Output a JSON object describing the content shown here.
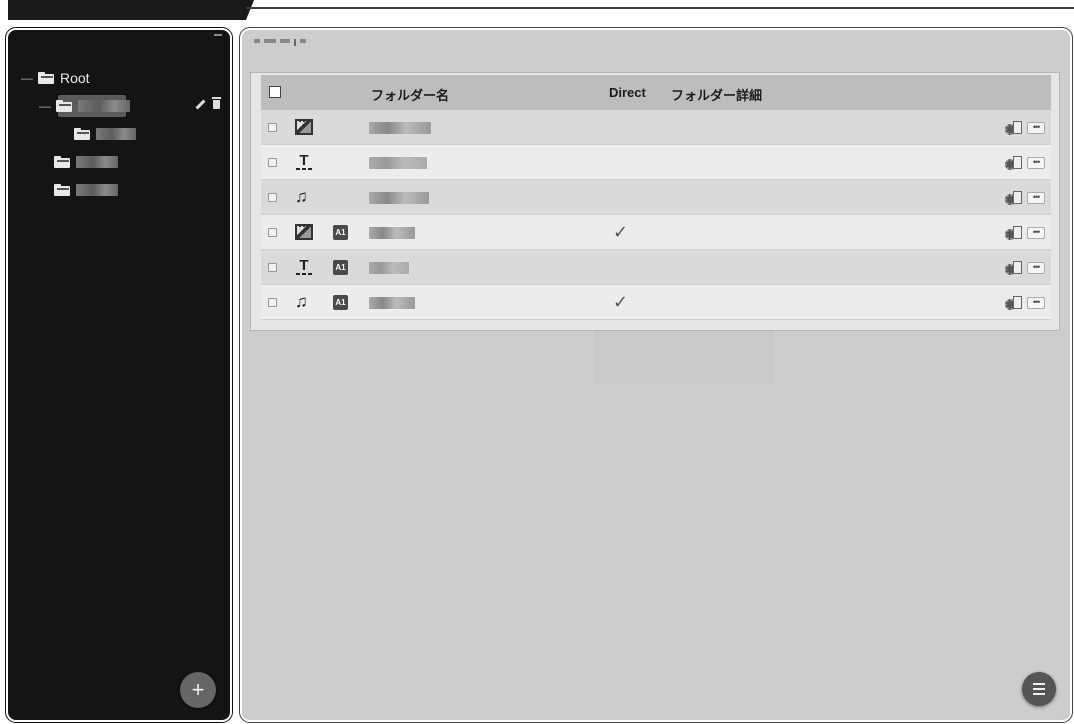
{
  "tree": {
    "root_label": "Root",
    "expand_symbol": "—"
  },
  "table": {
    "headers": {
      "name": "フォルダー名",
      "direct": "Direct",
      "detail": "フォルダー詳細"
    },
    "rows": [
      {
        "type": "image-icon",
        "a1": "",
        "direct": ""
      },
      {
        "type": "text-icon",
        "a1": "",
        "direct": ""
      },
      {
        "type": "music-icon",
        "a1": "",
        "direct": ""
      },
      {
        "type": "image-icon",
        "a1": "A1",
        "direct": "✓"
      },
      {
        "type": "text-icon",
        "a1": "A1",
        "direct": ""
      },
      {
        "type": "music-icon",
        "a1": "A1",
        "direct": "✓"
      }
    ],
    "text_icon_glyph": "T",
    "music_icon_glyph": "♫",
    "more_glyph": "•••"
  },
  "buttons": {
    "add_symbol": "+"
  }
}
